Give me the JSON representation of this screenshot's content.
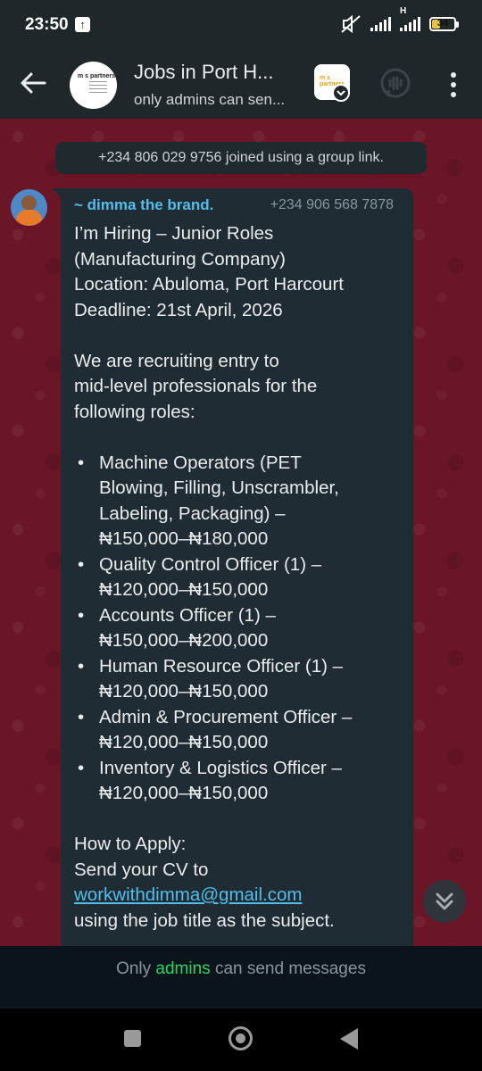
{
  "status_bar": {
    "time": "23:50",
    "battery": "34",
    "network_label": "H"
  },
  "header": {
    "title": "Jobs in Port H...",
    "subtitle": "only admins can sen...",
    "avatar_logo_text": "m s partners",
    "badge_logo_text": "m s partners"
  },
  "chat": {
    "system_message": "+234 806 029 9756 joined using a group link.",
    "message": {
      "sender_name": "~ dimma the brand.",
      "sender_phone": "+234 906 568 7878",
      "headline_lines": [
        "I’m Hiring – Junior Roles",
        "(Manufacturing Company)",
        "Location: Abuloma, Port Harcourt",
        "Deadline: 21st April, 2026"
      ],
      "intro_lines": [
        "We are recruiting entry to",
        "mid-level professionals for the",
        "following roles:"
      ],
      "bullet_char": "•",
      "roles": [
        [
          "Machine Operators (PET",
          "Blowing, Filling, Unscrambler,",
          "Labeling, Packaging) –",
          "₦150,000–₦180,000"
        ],
        [
          "Quality Control Officer (1) –",
          "₦120,000–₦150,000"
        ],
        [
          "Accounts Officer (1) –",
          "₦150,000–₦200,000"
        ],
        [
          "Human Resource Officer (1) –",
          "₦120,000–₦150,000"
        ],
        [
          "Admin & Procurement Officer –",
          "₦120,000–₦150,000"
        ],
        [
          "Inventory & Logistics Officer –",
          "₦120,000–₦150,000"
        ]
      ],
      "apply_heading": "How to Apply:",
      "apply_line": "Send your CV to",
      "email": "workwithdimma@gmail.com",
      "apply_tail": "using the job title as the subject."
    }
  },
  "footer": {
    "prefix": "Only ",
    "admins": "admins",
    "suffix": " can send messages"
  },
  "colors": {
    "header_bg": "#1f272a",
    "chat_wallpaper": "#6b1627",
    "bubble_bg": "#1f2c33",
    "sender_name": "#53bdeb",
    "link": "#53bdeb",
    "admins_green": "#25d366"
  },
  "icons": [
    "back-arrow-icon",
    "voice-chat-icon",
    "more-vert-icon",
    "double-chevron-down-icon",
    "upload-icon",
    "mute-icon",
    "signal-icon",
    "battery-icon"
  ]
}
